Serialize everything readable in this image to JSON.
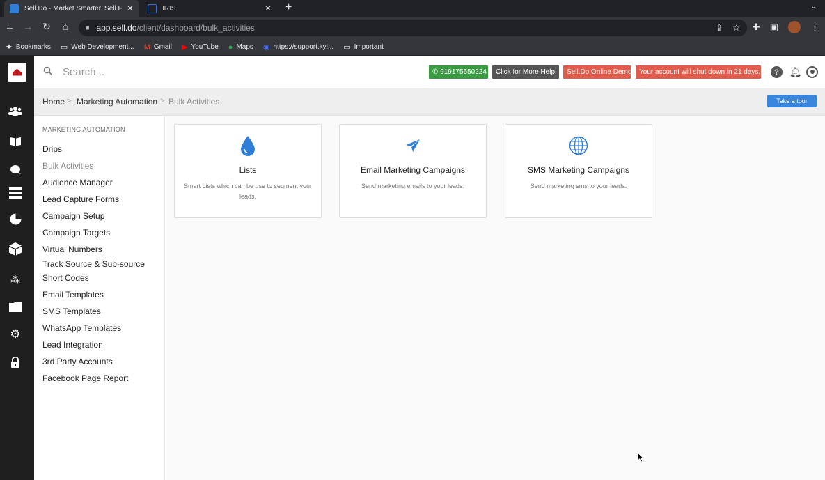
{
  "browser": {
    "tabs": [
      {
        "title": "Sell.Do - Market Smarter. Sell Fa",
        "close": "✕"
      },
      {
        "title": "IRIS",
        "close": "✕"
      }
    ],
    "new_tab": "+",
    "tab_menu": "⌄",
    "url_host": "app.sell.do",
    "url_path": "/client/dashboard/bulk_activities",
    "bookmarks": [
      {
        "label": "Bookmarks",
        "icon": "star-icon"
      },
      {
        "label": "Web Development...",
        "icon": "folder-icon"
      },
      {
        "label": "Gmail",
        "icon": "gmail-icon"
      },
      {
        "label": "YouTube",
        "icon": "youtube-icon"
      },
      {
        "label": "Maps",
        "icon": "maps-icon"
      },
      {
        "label": "https://support.kyl...",
        "icon": "site-icon"
      },
      {
        "label": "Important",
        "icon": "folder-icon"
      }
    ]
  },
  "header": {
    "search_placeholder": "Search...",
    "phone_label": "919175650224",
    "help_label": "Click for More Help!",
    "demo_label": "Sell.Do Online Demo",
    "shutdown_label": "Your account will shut down in 21 days.",
    "help_icon_text": "?"
  },
  "colors": {
    "rail_bg": "#1f1f1f",
    "accent_blue": "#3a86dc",
    "phone_green": "#3a9b43",
    "warning_red": "#e15c4d",
    "help_grey": "#555555"
  },
  "breadcrumb": {
    "home": "Home",
    "section": "Marketing Automation",
    "current": "Bulk Activities",
    "separator": ">"
  },
  "tour_button": "Take a tour",
  "sidemenu": {
    "title": "MARKETING AUTOMATION",
    "items": [
      {
        "label": "Drips",
        "active": false
      },
      {
        "label": "Bulk Activities",
        "active": true
      },
      {
        "label": "Audience Manager",
        "active": false
      },
      {
        "label": "Lead Capture Forms",
        "active": false
      },
      {
        "label": "Campaign Setup",
        "active": false
      },
      {
        "label": "Campaign Targets",
        "active": false
      },
      {
        "label": "Virtual Numbers",
        "active": false
      },
      {
        "label": "Track Source & Sub-source",
        "active": false
      },
      {
        "label": "Short Codes",
        "active": false
      },
      {
        "label": "Email Templates",
        "active": false
      },
      {
        "label": "SMS Templates",
        "active": false
      },
      {
        "label": "WhatsApp Templates",
        "active": false
      },
      {
        "label": "Lead Integration",
        "active": false
      },
      {
        "label": "3rd Party Accounts",
        "active": false
      },
      {
        "label": "Facebook Page Report",
        "active": false
      }
    ]
  },
  "cards": [
    {
      "title": "Lists",
      "description": "Smart Lists which can be use to segment your leads.",
      "icon": "droplet-icon"
    },
    {
      "title": "Email Marketing Campaigns",
      "description": "Send marketing emails to your leads.",
      "icon": "paper-plane-icon"
    },
    {
      "title": "SMS Marketing Campaigns",
      "description": "Send marketing sms to your leads.",
      "icon": "globe-icon"
    }
  ]
}
